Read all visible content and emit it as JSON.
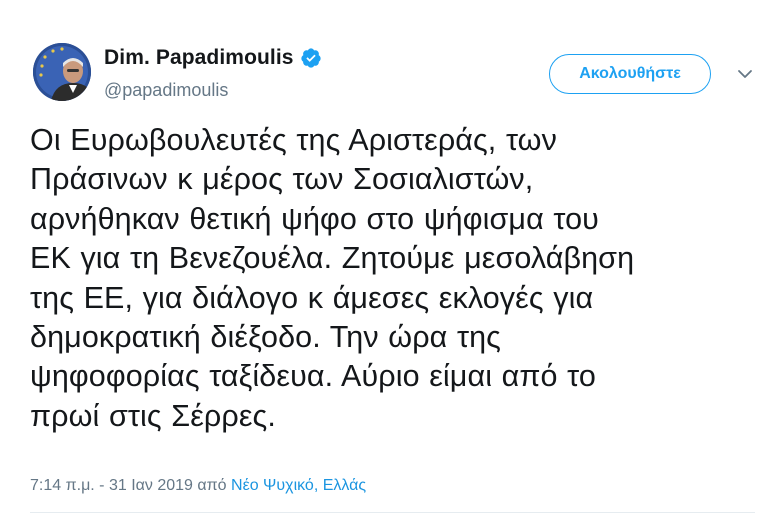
{
  "author": {
    "name": "Dim. Papadimoulis",
    "handle": "@papadimoulis",
    "verified_icon": "verified-badge-icon",
    "avatar_icon": "profile-photo"
  },
  "follow_button": {
    "label": "Ακολουθήστε"
  },
  "menu_icon": "chevron-down-icon",
  "tweet": {
    "lines": [
      "Οι Ευρωβουλευτές της Αριστεράς, των",
      "Πράσινων κ μέρος των Σοσιαλιστών,",
      "αρνήθηκαν θετική ψήφο στο ψήφισμα του",
      "ΕΚ για τη Βενεζουέλα. Ζητούμε μεσολάβηση",
      "της ΕΕ, για διάλογο κ άμεσες εκλογές για",
      "δημοκρατική διέξοδο. Την ώρα της",
      "ψηφοφορίας ταξίδευα. Αύριο είμαι από το",
      "πρωί στις Σέρρες."
    ],
    "timestamp": "7:14 π.μ. - 31 Ιαν 2019 από",
    "location": "Νέο Ψυχικό, Ελλάς"
  },
  "colors": {
    "accent": "#1da1f2",
    "link": "#1b95e0",
    "muted": "#657786",
    "text": "#14171a"
  }
}
